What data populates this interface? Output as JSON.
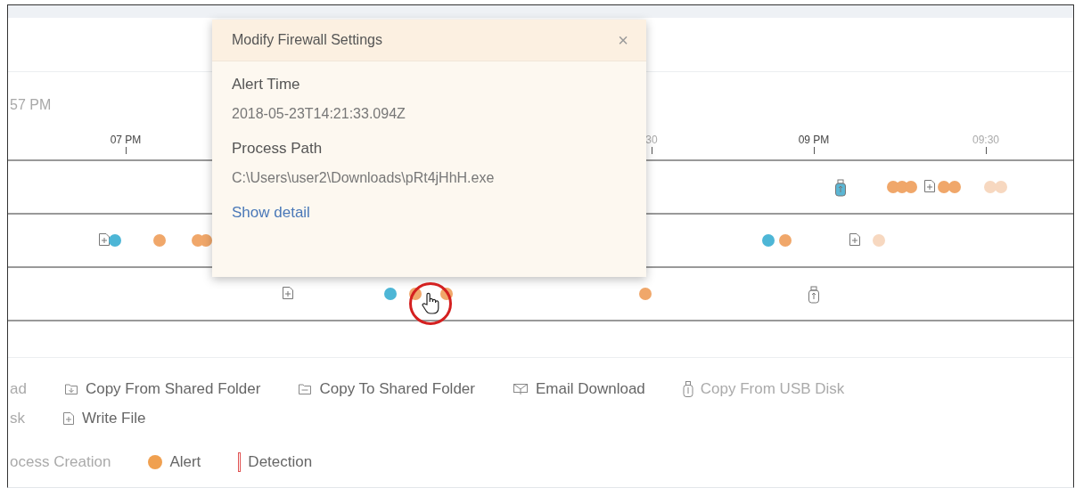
{
  "axis": {
    "start_label": "57 PM",
    "ticks": [
      {
        "label": "07 PM",
        "major": true
      },
      {
        "label": "30",
        "major": false
      },
      {
        "label": "09 PM",
        "major": true
      },
      {
        "label": "09:30",
        "major": false
      }
    ]
  },
  "lanes": [
    {
      "events": [
        {
          "kind": "usb",
          "muted": false
        },
        {
          "kind": "alert",
          "muted": false
        },
        {
          "kind": "alert",
          "muted": false
        },
        {
          "kind": "alert",
          "muted": false
        },
        {
          "kind": "file",
          "muted": false
        },
        {
          "kind": "alert",
          "muted": false
        },
        {
          "kind": "alert",
          "muted": false
        },
        {
          "kind": "alert",
          "muted": true
        },
        {
          "kind": "alert",
          "muted": true
        }
      ]
    },
    {
      "events": [
        {
          "kind": "file",
          "muted": false
        },
        {
          "kind": "process",
          "muted": false
        },
        {
          "kind": "alert",
          "muted": false
        },
        {
          "kind": "alert",
          "muted": false
        },
        {
          "kind": "alert",
          "muted": false
        },
        {
          "kind": "process",
          "muted": false
        },
        {
          "kind": "alert",
          "muted": false
        },
        {
          "kind": "file",
          "muted": false
        },
        {
          "kind": "alert",
          "muted": true
        }
      ]
    },
    {
      "events": [
        {
          "kind": "file",
          "muted": false
        },
        {
          "kind": "process",
          "muted": false
        },
        {
          "kind": "alert",
          "muted": false
        },
        {
          "kind": "alert",
          "muted": false
        },
        {
          "kind": "alert",
          "muted": false
        },
        {
          "kind": "usb",
          "muted": false
        }
      ]
    }
  ],
  "popup": {
    "title": "Modify Firewall Settings",
    "close": "×",
    "fields": [
      {
        "label": "Alert Time",
        "value": "2018-05-23T14:21:33.094Z"
      },
      {
        "label": "Process Path",
        "value": "C:\\Users\\user2\\Downloads\\pRt4jHhH.exe"
      }
    ],
    "link": "Show detail"
  },
  "legend": [
    [
      {
        "kind": "none",
        "label": "ad",
        "faded": true
      },
      {
        "kind": "folder-in",
        "label": "Copy From Shared Folder",
        "faded": false
      },
      {
        "kind": "folder",
        "label": "Copy To Shared Folder",
        "faded": false
      },
      {
        "kind": "email",
        "label": "Email Download",
        "faded": false
      },
      {
        "kind": "usb",
        "label": "Copy From USB Disk",
        "faded": true
      }
    ],
    [
      {
        "kind": "none",
        "label": "sk",
        "faded": true
      },
      {
        "kind": "file",
        "label": "Write File",
        "faded": false
      }
    ],
    [
      {
        "kind": "none",
        "label": "ocess Creation",
        "faded": true
      },
      {
        "kind": "alert",
        "label": "Alert",
        "faded": false
      },
      {
        "kind": "detection",
        "label": "Detection",
        "faded": false
      }
    ]
  ]
}
